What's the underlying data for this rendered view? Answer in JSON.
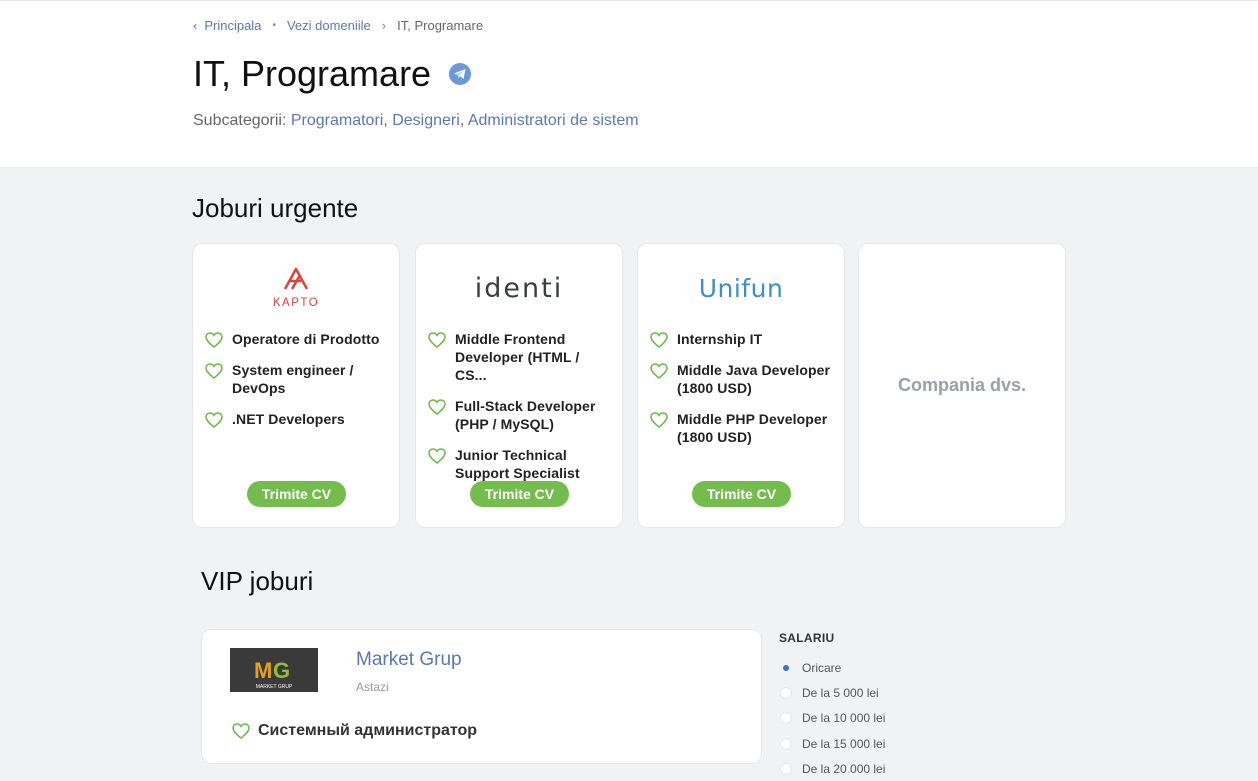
{
  "breadcrumb": {
    "items": [
      "Principala",
      "Vezi domeniile",
      "IT, Programare"
    ]
  },
  "header": {
    "title": "IT, Programare",
    "subcategories_label": "Subcategorii:",
    "subcategories": [
      "Programatori",
      "Designeri",
      "Administratori de sistem"
    ]
  },
  "urgent": {
    "title": "Joburi urgente",
    "cards": [
      {
        "company_logo": "KAPTO",
        "jobs": [
          "Operatore di Prodotto",
          "System engineer / DevOps",
          ".NET Developers"
        ],
        "button": "Trimite CV"
      },
      {
        "company_logo": "identi",
        "jobs": [
          "Middle Frontend Developer (HTML / CS...",
          "Full-Stack Developer (PHP / MySQL)",
          "Junior Technical Support Specialist"
        ],
        "button": "Trimite CV"
      },
      {
        "company_logo": "Unifun",
        "jobs": [
          "Internship IT",
          "Middle Java Developer (1800 USD)",
          "Middle PHP Developer (1800 USD)"
        ],
        "button": "Trimite CV"
      }
    ],
    "placeholder": "Compania dvs."
  },
  "vip": {
    "title": "VIP joburi",
    "company": "Market Grup",
    "date": "Astazi",
    "logo_text": "MARKET GRUP",
    "job": "Системный администратор"
  },
  "salary_filter": {
    "title": "SALARIU",
    "selected": 0,
    "options": [
      "Oricare",
      "De la 5 000 lei",
      "De la 10 000 lei",
      "De la 15 000 lei",
      "De la 20 000 lei"
    ]
  },
  "colors": {
    "link": "#5b78b2",
    "accent_green": "#74bd4d",
    "background": "#f1f2f4"
  },
  "icons": [
    "chevron-left-icon",
    "telegram-icon",
    "heart-icon"
  ]
}
